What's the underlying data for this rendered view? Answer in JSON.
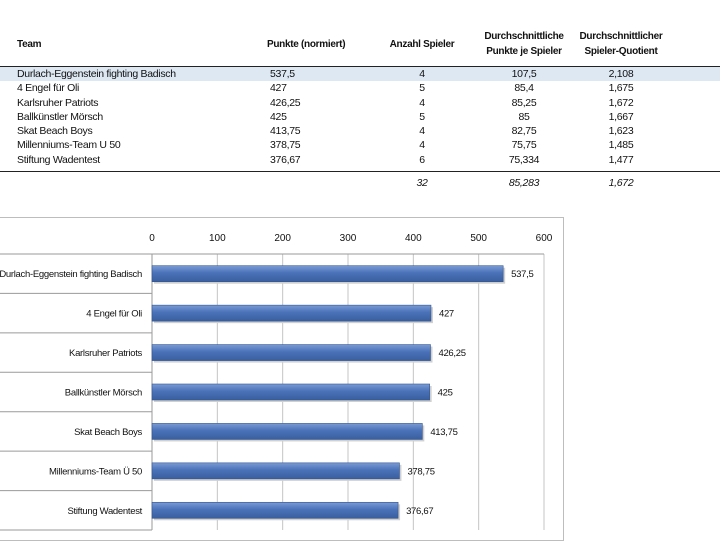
{
  "table": {
    "headers": {
      "team": "Team",
      "points": "Punkte (normiert)",
      "players": "Anzahl Spieler",
      "avg_points_l1": "Durchschnittliche",
      "avg_points_l2": "Punkte je Spieler",
      "quotient_l1": "Durchschnittlicher",
      "quotient_l2": "Spieler-Quotient"
    },
    "rows": [
      {
        "team": "Durlach-Eggenstein fighting Badisch",
        "points": "537,5",
        "players": "4",
        "avg": "107,5",
        "quotient": "2,108"
      },
      {
        "team": "4 Engel für Oli",
        "points": "427",
        "players": "5",
        "avg": "85,4",
        "quotient": "1,675"
      },
      {
        "team": "Karlsruher Patriots",
        "points": "426,25",
        "players": "4",
        "avg": "85,25",
        "quotient": "1,672"
      },
      {
        "team": "Ballkünstler Mörsch",
        "points": "425",
        "players": "5",
        "avg": "85",
        "quotient": "1,667"
      },
      {
        "team": "Skat Beach Boys",
        "points": "413,75",
        "players": "4",
        "avg": "82,75",
        "quotient": "1,623"
      },
      {
        "team": "Millenniums-Team U 50",
        "points": "378,75",
        "players": "4",
        "avg": "75,75",
        "quotient": "1,485"
      },
      {
        "team": "Stiftung Wadentest",
        "points": "376,67",
        "players": "6",
        "avg": "75,334",
        "quotient": "1,477"
      }
    ],
    "totals": {
      "players": "32",
      "avg": "85,283",
      "quotient": "1,672"
    }
  },
  "chart_data": {
    "type": "bar",
    "orientation": "horizontal",
    "categories": [
      "Durlach-Eggenstein fighting Badisch",
      "4 Engel für Oli",
      "Karlsruher Patriots",
      "Ballkünstler Mörsch",
      "Skat Beach Boys",
      "Millenniums-Team Ü 50",
      "Stiftung Wadentest"
    ],
    "values": [
      537.5,
      427,
      426.25,
      425,
      413.75,
      378.75,
      376.67
    ],
    "value_labels": [
      "537,5",
      "427",
      "426,25",
      "425",
      "413,75",
      "378,75",
      "376,67"
    ],
    "xticks": [
      0,
      100,
      200,
      300,
      400,
      500,
      600
    ],
    "xlim": [
      0,
      600
    ],
    "grid": true,
    "legend": false,
    "bar_color": "#4a72b8"
  }
}
